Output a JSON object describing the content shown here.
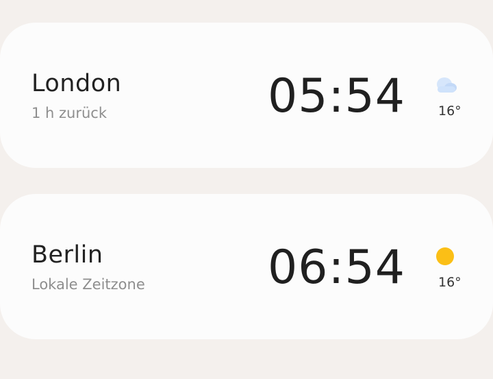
{
  "clocks": [
    {
      "city": "London",
      "subtitle": "1 h zurück",
      "time": "05:54",
      "temperature": "16°",
      "weather_icon": "cloud-icon",
      "weather_color": "#cfe2fb"
    },
    {
      "city": "Berlin",
      "subtitle": "Lokale Zeitzone",
      "time": "06:54",
      "temperature": "16°",
      "weather_icon": "sun-icon",
      "weather_color": "#fbbf16"
    }
  ]
}
